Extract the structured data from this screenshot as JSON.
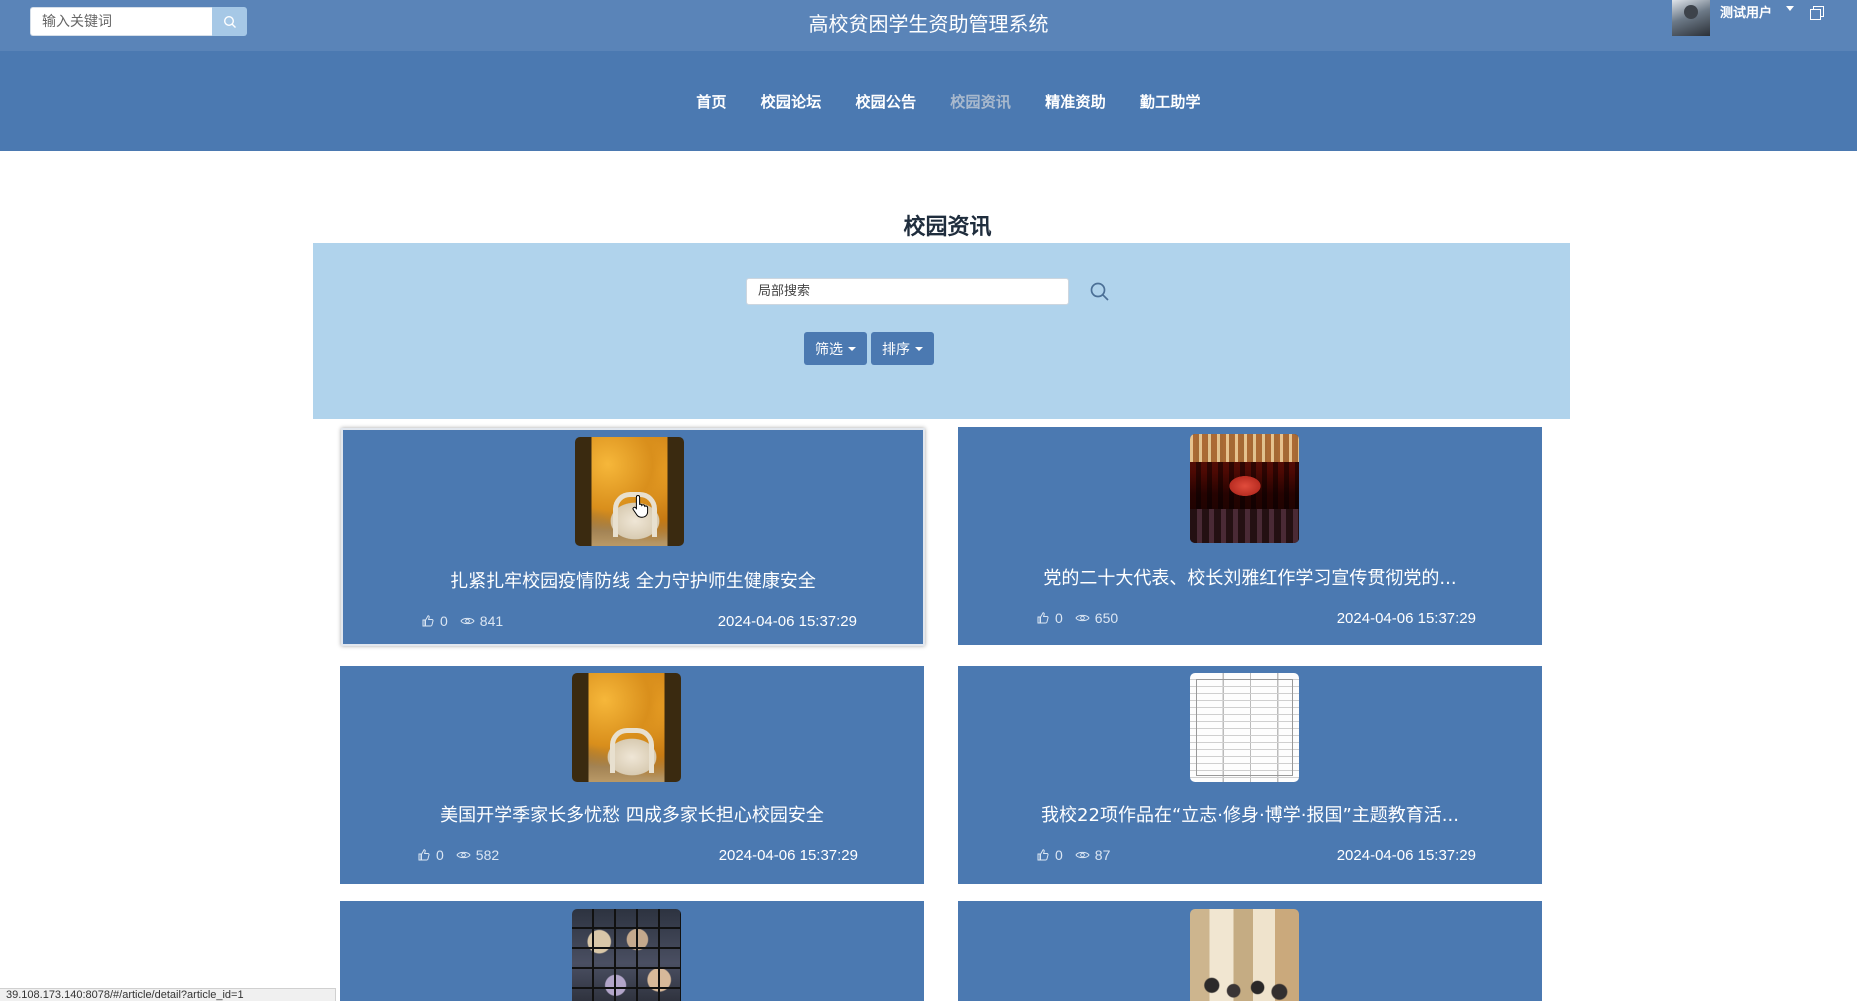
{
  "header": {
    "search_placeholder": "输入关键词",
    "title": "高校贫困学生资助管理系统",
    "user_name": "测试用户"
  },
  "nav": {
    "items": [
      {
        "label": "首页",
        "active": false
      },
      {
        "label": "校园论坛",
        "active": false
      },
      {
        "label": "校园公告",
        "active": false
      },
      {
        "label": "校园资讯",
        "active": true
      },
      {
        "label": "精准资助",
        "active": false
      },
      {
        "label": "勤工助学",
        "active": false
      }
    ]
  },
  "page": {
    "title": "校园资讯",
    "local_search_placeholder": "局部搜索",
    "filter_label": "筛选",
    "sort_label": "排序"
  },
  "articles": [
    {
      "title": "扎紧扎牢校园疫情防线 全力守护师生健康安全",
      "likes": "0",
      "views": "841",
      "date": "2024-04-06 15:37:29",
      "thumb": "autumn-campus-gate"
    },
    {
      "title": "党的二十大代表、校长刘雅红作学习宣传贯彻党的...",
      "likes": "0",
      "views": "650",
      "date": "2024-04-06 15:37:29",
      "thumb": "auditorium-meeting"
    },
    {
      "title": "美国开学季家长多忧愁 四成多家长担心校园安全",
      "likes": "0",
      "views": "582",
      "date": "2024-04-06 15:37:29",
      "thumb": "autumn-campus-gate"
    },
    {
      "title": "我校22项作品在“立志·修身·博学·报国”主题教育活...",
      "likes": "0",
      "views": "87",
      "date": "2024-04-06 15:37:29",
      "thumb": "document-table"
    },
    {
      "title": "",
      "likes": "",
      "views": "",
      "date": "",
      "thumb": "photo-grid"
    },
    {
      "title": "",
      "likes": "",
      "views": "",
      "date": "",
      "thumb": "meeting-room"
    }
  ],
  "status_bar": {
    "url": "39.108.173.140:8078/#/article/detail?article_id=1"
  },
  "colors": {
    "header_bg": "#5a84b8",
    "nav_bg": "#4b79b1",
    "panel_bg": "#b0d3ec",
    "card_bg": "#4b79b1",
    "active_nav": "#a9b9cd"
  }
}
